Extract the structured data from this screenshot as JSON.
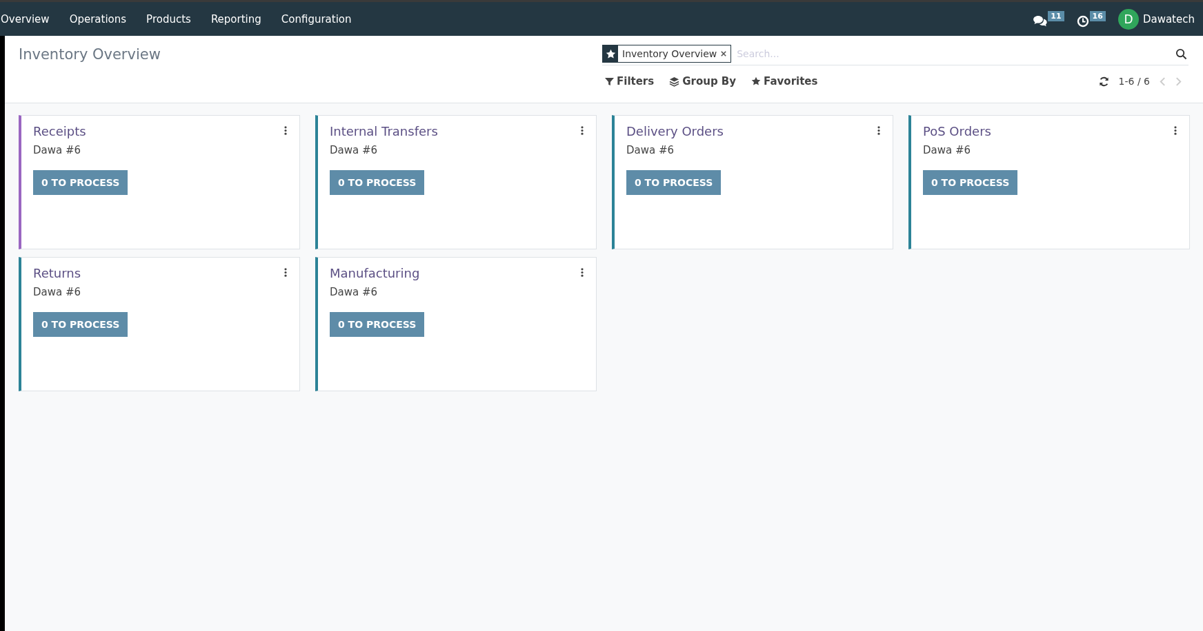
{
  "menu": [
    {
      "label": "Overview"
    },
    {
      "label": "Operations"
    },
    {
      "label": "Products"
    },
    {
      "label": "Reporting"
    },
    {
      "label": "Configuration"
    }
  ],
  "systray": {
    "messages_count": "11",
    "activities_count": "16",
    "user_initial": "D",
    "user_name": "Dawatech"
  },
  "title": "Inventory Overview",
  "search": {
    "facet": "Inventory Overview",
    "placeholder": "Search..."
  },
  "search_options": [
    {
      "label": "Filters",
      "kind": "filter"
    },
    {
      "label": "Group By",
      "kind": "group"
    },
    {
      "label": "Favorites",
      "kind": "star"
    }
  ],
  "pager": "1-6 / 6",
  "cards": [
    {
      "name": "Receipts",
      "warehouse": "Dawa #6",
      "action": "0 TO PROCESS",
      "color": "#9a66c1"
    },
    {
      "name": "Internal Transfers",
      "warehouse": "Dawa #6",
      "action": "0 TO PROCESS",
      "color": "#2c8397"
    },
    {
      "name": "Delivery Orders",
      "warehouse": "Dawa #6",
      "action": "0 TO PROCESS",
      "color": "#2c8397"
    },
    {
      "name": "PoS Orders",
      "warehouse": "Dawa #6",
      "action": "0 TO PROCESS",
      "color": "#2c8397"
    },
    {
      "name": "Returns",
      "warehouse": "Dawa #6",
      "action": "0 TO PROCESS",
      "color": "#2c8397"
    },
    {
      "name": "Manufacturing",
      "warehouse": "Dawa #6",
      "action": "0 TO PROCESS",
      "color": "#2c8397"
    }
  ]
}
